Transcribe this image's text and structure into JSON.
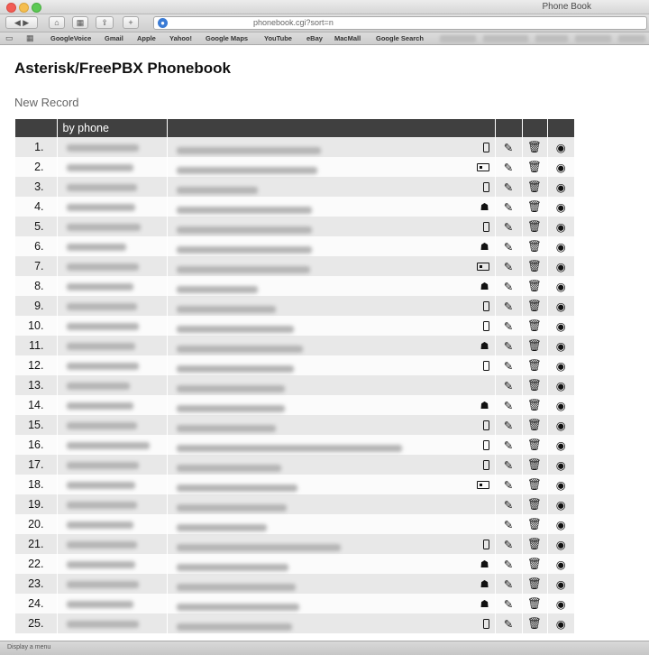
{
  "window": {
    "title": "Phone Book"
  },
  "toolbar": {
    "url": "phonebook.cgi?sort=n"
  },
  "bookmarks": [
    "GoogleVoice",
    "Gmail",
    "Apple",
    "Yahoo!",
    "Google Maps",
    "YouTube",
    "eBay",
    "MacMall",
    "Google Search"
  ],
  "page": {
    "title": "Asterisk/FreePBX Phonebook",
    "new_record": "New Record"
  },
  "table": {
    "sort_header": "by phone",
    "rows": [
      {
        "num": "1.",
        "type": "mobile"
      },
      {
        "num": "2.",
        "type": "card"
      },
      {
        "num": "3.",
        "type": "mobile"
      },
      {
        "num": "4.",
        "type": "home"
      },
      {
        "num": "5.",
        "type": "mobile"
      },
      {
        "num": "6.",
        "type": "home"
      },
      {
        "num": "7.",
        "type": "card"
      },
      {
        "num": "8.",
        "type": "home"
      },
      {
        "num": "9.",
        "type": "mobile"
      },
      {
        "num": "10.",
        "type": "mobile"
      },
      {
        "num": "11.",
        "type": "home"
      },
      {
        "num": "12.",
        "type": "mobile"
      },
      {
        "num": "13.",
        "type": ""
      },
      {
        "num": "14.",
        "type": "home"
      },
      {
        "num": "15.",
        "type": "mobile"
      },
      {
        "num": "16.",
        "type": "mobile"
      },
      {
        "num": "17.",
        "type": "mobile"
      },
      {
        "num": "18.",
        "type": "card"
      },
      {
        "num": "19.",
        "type": ""
      },
      {
        "num": "20.",
        "type": ""
      },
      {
        "num": "21.",
        "type": "mobile"
      },
      {
        "num": "22.",
        "type": "home"
      },
      {
        "num": "23.",
        "type": "home"
      },
      {
        "num": "24.",
        "type": "home"
      },
      {
        "num": "25.",
        "type": "mobile"
      }
    ]
  },
  "icons": {
    "edit": "edit-icon",
    "delete": "trash-icon",
    "view": "eye-icon"
  },
  "status": {
    "text": "Display a menu"
  }
}
